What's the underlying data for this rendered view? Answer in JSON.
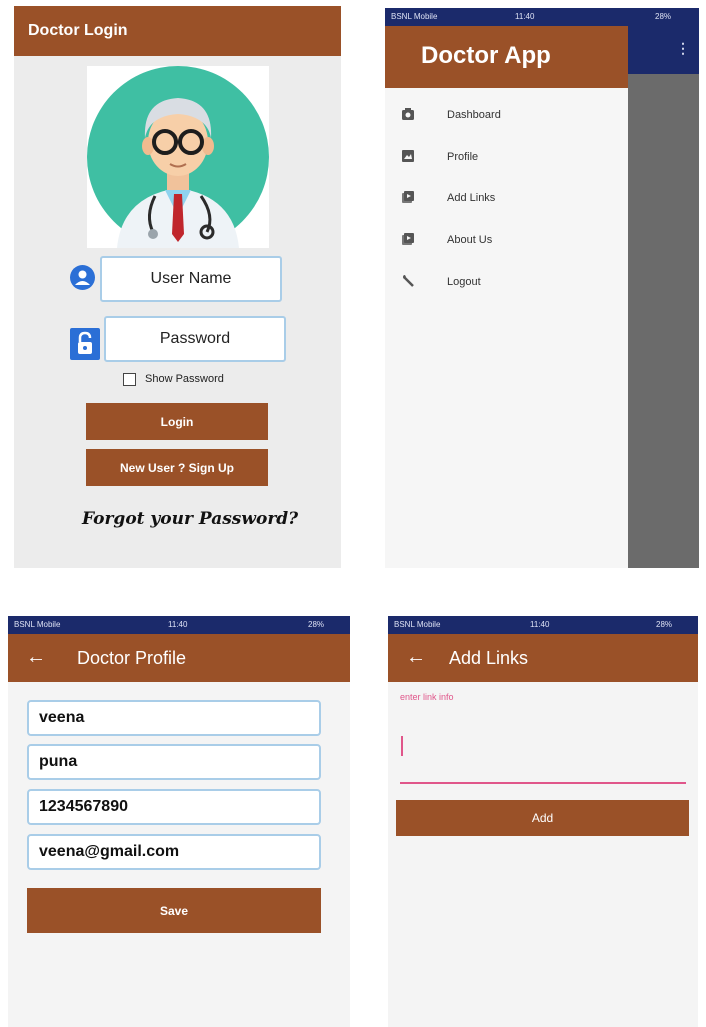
{
  "colors": {
    "accent": "#9a5128",
    "status_bar": "#1b2a6b",
    "field_border": "#a9cde8",
    "link_pink": "#e0568a"
  },
  "login": {
    "title": "Doctor Login",
    "username_placeholder": "User Name",
    "password_placeholder": "Password",
    "show_password_label": "Show Password",
    "login_button": "Login",
    "signup_button": "New User ? Sign Up",
    "forgot_text": "Forgot your Password?"
  },
  "drawer": {
    "status": {
      "carrier": "BSNL Mobile",
      "time": "11:40",
      "battery": "28%"
    },
    "header": "Doctor App",
    "items": [
      {
        "label": "Dashboard",
        "icon": "camera-icon"
      },
      {
        "label": "Profile",
        "icon": "image-icon"
      },
      {
        "label": "Add Links",
        "icon": "media-icon"
      },
      {
        "label": "About Us",
        "icon": "media-icon"
      },
      {
        "label": "Logout",
        "icon": "wrench-icon"
      }
    ]
  },
  "profile": {
    "status": {
      "carrier": "BSNL Mobile",
      "time": "11:40",
      "battery": "28%"
    },
    "title": "Doctor Profile",
    "fields": [
      "veena",
      "puna",
      "1234567890",
      "veena@gmail.com"
    ],
    "save_button": "Save"
  },
  "links": {
    "status": {
      "carrier": "BSNL Mobile",
      "time": "11:40",
      "battery": "28%"
    },
    "title": "Add Links",
    "input_label": "enter link info",
    "add_button": "Add"
  }
}
